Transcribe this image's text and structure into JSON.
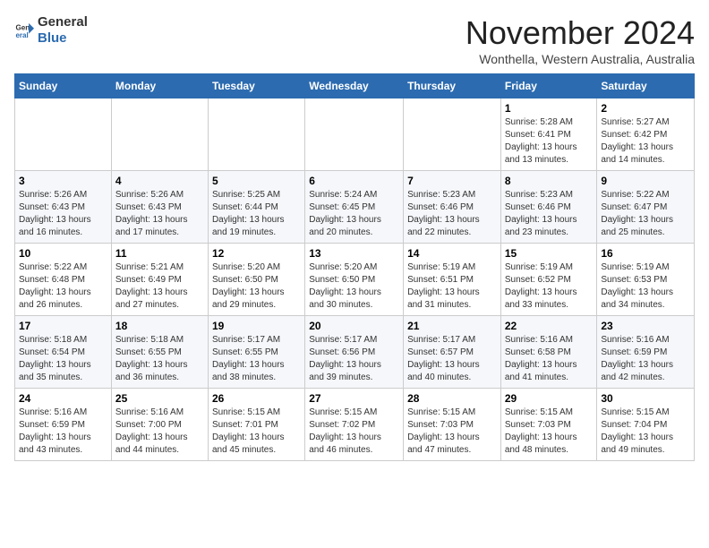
{
  "logo": {
    "text_general": "General",
    "text_blue": "Blue"
  },
  "title": "November 2024",
  "location": "Wonthella, Western Australia, Australia",
  "weekdays": [
    "Sunday",
    "Monday",
    "Tuesday",
    "Wednesday",
    "Thursday",
    "Friday",
    "Saturday"
  ],
  "weeks": [
    [
      {
        "day": "",
        "detail": ""
      },
      {
        "day": "",
        "detail": ""
      },
      {
        "day": "",
        "detail": ""
      },
      {
        "day": "",
        "detail": ""
      },
      {
        "day": "",
        "detail": ""
      },
      {
        "day": "1",
        "detail": "Sunrise: 5:28 AM\nSunset: 6:41 PM\nDaylight: 13 hours\nand 13 minutes."
      },
      {
        "day": "2",
        "detail": "Sunrise: 5:27 AM\nSunset: 6:42 PM\nDaylight: 13 hours\nand 14 minutes."
      }
    ],
    [
      {
        "day": "3",
        "detail": "Sunrise: 5:26 AM\nSunset: 6:43 PM\nDaylight: 13 hours\nand 16 minutes."
      },
      {
        "day": "4",
        "detail": "Sunrise: 5:26 AM\nSunset: 6:43 PM\nDaylight: 13 hours\nand 17 minutes."
      },
      {
        "day": "5",
        "detail": "Sunrise: 5:25 AM\nSunset: 6:44 PM\nDaylight: 13 hours\nand 19 minutes."
      },
      {
        "day": "6",
        "detail": "Sunrise: 5:24 AM\nSunset: 6:45 PM\nDaylight: 13 hours\nand 20 minutes."
      },
      {
        "day": "7",
        "detail": "Sunrise: 5:23 AM\nSunset: 6:46 PM\nDaylight: 13 hours\nand 22 minutes."
      },
      {
        "day": "8",
        "detail": "Sunrise: 5:23 AM\nSunset: 6:46 PM\nDaylight: 13 hours\nand 23 minutes."
      },
      {
        "day": "9",
        "detail": "Sunrise: 5:22 AM\nSunset: 6:47 PM\nDaylight: 13 hours\nand 25 minutes."
      }
    ],
    [
      {
        "day": "10",
        "detail": "Sunrise: 5:22 AM\nSunset: 6:48 PM\nDaylight: 13 hours\nand 26 minutes."
      },
      {
        "day": "11",
        "detail": "Sunrise: 5:21 AM\nSunset: 6:49 PM\nDaylight: 13 hours\nand 27 minutes."
      },
      {
        "day": "12",
        "detail": "Sunrise: 5:20 AM\nSunset: 6:50 PM\nDaylight: 13 hours\nand 29 minutes."
      },
      {
        "day": "13",
        "detail": "Sunrise: 5:20 AM\nSunset: 6:50 PM\nDaylight: 13 hours\nand 30 minutes."
      },
      {
        "day": "14",
        "detail": "Sunrise: 5:19 AM\nSunset: 6:51 PM\nDaylight: 13 hours\nand 31 minutes."
      },
      {
        "day": "15",
        "detail": "Sunrise: 5:19 AM\nSunset: 6:52 PM\nDaylight: 13 hours\nand 33 minutes."
      },
      {
        "day": "16",
        "detail": "Sunrise: 5:19 AM\nSunset: 6:53 PM\nDaylight: 13 hours\nand 34 minutes."
      }
    ],
    [
      {
        "day": "17",
        "detail": "Sunrise: 5:18 AM\nSunset: 6:54 PM\nDaylight: 13 hours\nand 35 minutes."
      },
      {
        "day": "18",
        "detail": "Sunrise: 5:18 AM\nSunset: 6:55 PM\nDaylight: 13 hours\nand 36 minutes."
      },
      {
        "day": "19",
        "detail": "Sunrise: 5:17 AM\nSunset: 6:55 PM\nDaylight: 13 hours\nand 38 minutes."
      },
      {
        "day": "20",
        "detail": "Sunrise: 5:17 AM\nSunset: 6:56 PM\nDaylight: 13 hours\nand 39 minutes."
      },
      {
        "day": "21",
        "detail": "Sunrise: 5:17 AM\nSunset: 6:57 PM\nDaylight: 13 hours\nand 40 minutes."
      },
      {
        "day": "22",
        "detail": "Sunrise: 5:16 AM\nSunset: 6:58 PM\nDaylight: 13 hours\nand 41 minutes."
      },
      {
        "day": "23",
        "detail": "Sunrise: 5:16 AM\nSunset: 6:59 PM\nDaylight: 13 hours\nand 42 minutes."
      }
    ],
    [
      {
        "day": "24",
        "detail": "Sunrise: 5:16 AM\nSunset: 6:59 PM\nDaylight: 13 hours\nand 43 minutes."
      },
      {
        "day": "25",
        "detail": "Sunrise: 5:16 AM\nSunset: 7:00 PM\nDaylight: 13 hours\nand 44 minutes."
      },
      {
        "day": "26",
        "detail": "Sunrise: 5:15 AM\nSunset: 7:01 PM\nDaylight: 13 hours\nand 45 minutes."
      },
      {
        "day": "27",
        "detail": "Sunrise: 5:15 AM\nSunset: 7:02 PM\nDaylight: 13 hours\nand 46 minutes."
      },
      {
        "day": "28",
        "detail": "Sunrise: 5:15 AM\nSunset: 7:03 PM\nDaylight: 13 hours\nand 47 minutes."
      },
      {
        "day": "29",
        "detail": "Sunrise: 5:15 AM\nSunset: 7:03 PM\nDaylight: 13 hours\nand 48 minutes."
      },
      {
        "day": "30",
        "detail": "Sunrise: 5:15 AM\nSunset: 7:04 PM\nDaylight: 13 hours\nand 49 minutes."
      }
    ]
  ]
}
